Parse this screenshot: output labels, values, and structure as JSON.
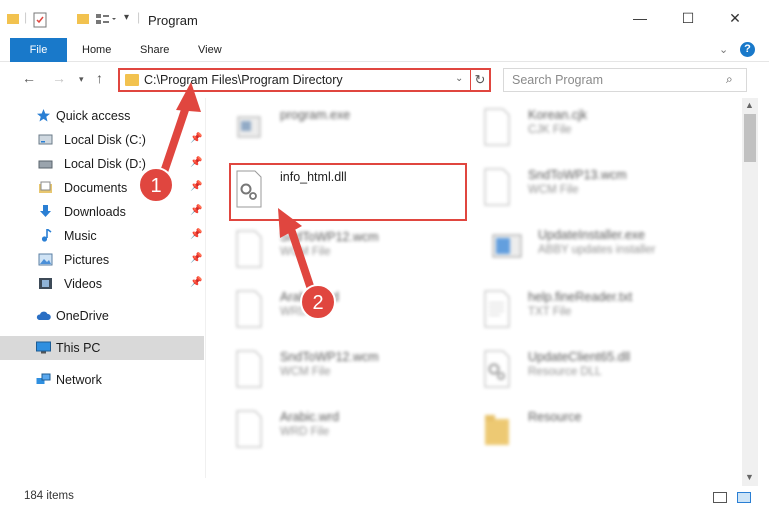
{
  "window": {
    "title": "Program",
    "minimize": "—",
    "maximize": "☐",
    "close": "✕"
  },
  "ribbon": {
    "file": "File",
    "tabs": [
      "Home",
      "Share",
      "View"
    ],
    "help": "?"
  },
  "nav": {
    "address": "C:\\Program Files\\Program Directory",
    "search_placeholder": "Search Program"
  },
  "sidebar": {
    "items": [
      {
        "label": "Quick access"
      },
      {
        "label": "Local Disk (C:)"
      },
      {
        "label": "Local Disk (D:)"
      },
      {
        "label": "Documents"
      },
      {
        "label": "Downloads"
      },
      {
        "label": "Music"
      },
      {
        "label": "Pictures"
      },
      {
        "label": "Videos"
      },
      {
        "label": "OneDrive"
      },
      {
        "label": "This PC"
      },
      {
        "label": "Network"
      }
    ]
  },
  "files": {
    "left": [
      {
        "name": "program.exe",
        "type": ""
      },
      {
        "name": "info_html.dll",
        "type": ""
      },
      {
        "name": "SndToWP12.wcm",
        "type": "WCM File"
      },
      {
        "name": "Arabic.wrd",
        "type": "WRD File"
      },
      {
        "name": "SndToWP12.wcm",
        "type": "WCM File"
      },
      {
        "name": "Arabic.wrd",
        "type": "WRD File"
      }
    ],
    "right": [
      {
        "name": "Korean.cjk",
        "type": "CJK File"
      },
      {
        "name": "SndToWP13.wcm",
        "type": "WCM File"
      },
      {
        "name": "UpdateInstaller.exe",
        "type": "ABBY updates installer"
      },
      {
        "name": "help.fineReader.txt",
        "type": "TXT File"
      },
      {
        "name": "UpdateClient65.dll",
        "type": "Resource DLL"
      },
      {
        "name": "Resource",
        "type": ""
      }
    ]
  },
  "status": {
    "item_count": "184 items"
  },
  "callouts": {
    "one": "1",
    "two": "2",
    "color": "#e0463f"
  }
}
